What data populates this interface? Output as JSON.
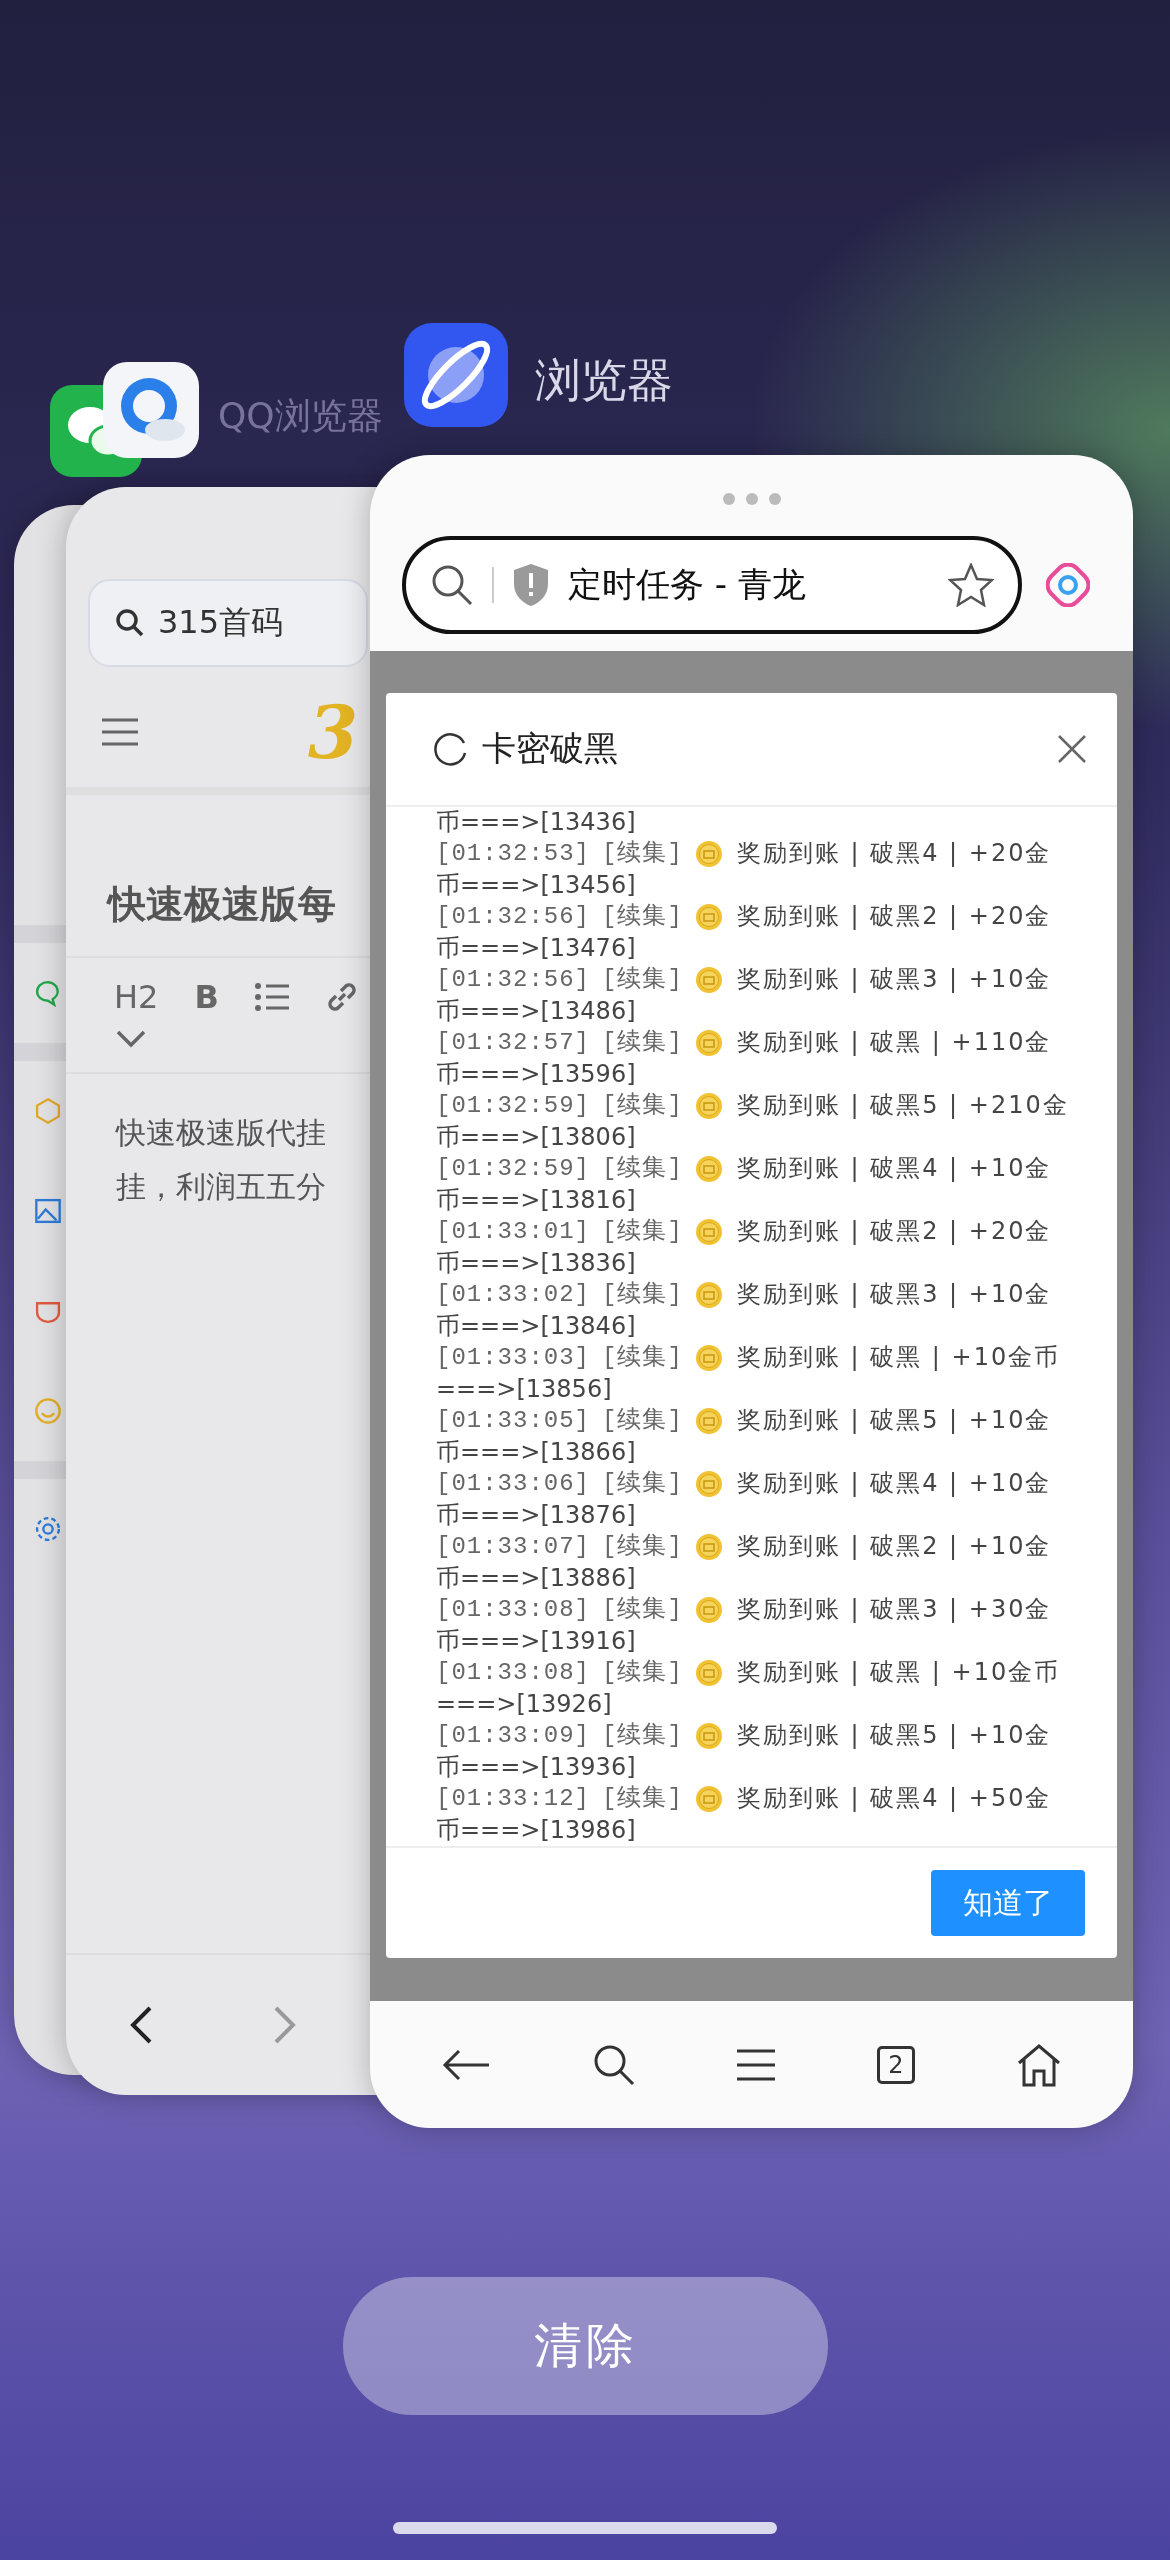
{
  "qq_browser_card": {
    "label": "QQ浏览器",
    "search": {
      "value": "315首码"
    },
    "logo_text": "3",
    "title": "快速极速版每",
    "toolbar": [
      "H2",
      "B"
    ],
    "body": [
      "快速极速版代挂",
      "挂，利润五五分"
    ],
    "nav": [
      {
        "kind": "back",
        "disabled": false
      },
      {
        "kind": "forward",
        "disabled": true
      }
    ]
  },
  "browser_card": {
    "label": "浏览器",
    "address": {
      "title": "定时任务 - 青龙"
    },
    "dialog": {
      "title": "卡密破黑",
      "log": [
        {
          "kind": "fragment",
          "text": "币===>[13436]"
        },
        {
          "kind": "entry",
          "time": "[01:32:53]",
          "tag": "[续集]",
          "message": "奖励到账 | 破黑4 | +20金",
          "continuation": "币===>[13456]"
        },
        {
          "kind": "entry",
          "time": "[01:32:56]",
          "tag": "[续集]",
          "message": "奖励到账 | 破黑2 | +20金",
          "continuation": "币===>[13476]"
        },
        {
          "kind": "entry",
          "time": "[01:32:56]",
          "tag": "[续集]",
          "message": "奖励到账 | 破黑3 | +10金",
          "continuation": "币===>[13486]"
        },
        {
          "kind": "entry",
          "time": "[01:32:57]",
          "tag": "[续集]",
          "message": "奖励到账 | 破黑 | +110金",
          "continuation": "币===>[13596]"
        },
        {
          "kind": "entry",
          "time": "[01:32:59]",
          "tag": "[续集]",
          "message": "奖励到账 | 破黑5 | +210金",
          "continuation": "币===>[13806]"
        },
        {
          "kind": "entry",
          "time": "[01:32:59]",
          "tag": "[续集]",
          "message": "奖励到账 | 破黑4 | +10金",
          "continuation": "币===>[13816]"
        },
        {
          "kind": "entry",
          "time": "[01:33:01]",
          "tag": "[续集]",
          "message": "奖励到账 | 破黑2 | +20金",
          "continuation": "币===>[13836]"
        },
        {
          "kind": "entry",
          "time": "[01:33:02]",
          "tag": "[续集]",
          "message": "奖励到账 | 破黑3 | +10金",
          "continuation": "币===>[13846]"
        },
        {
          "kind": "entry",
          "time": "[01:33:03]",
          "tag": "[续集]",
          "message": "奖励到账 | 破黑 | +10金币",
          "continuation": "===>[13856]"
        },
        {
          "kind": "entry",
          "time": "[01:33:05]",
          "tag": "[续集]",
          "message": "奖励到账 | 破黑5 | +10金",
          "continuation": "币===>[13866]"
        },
        {
          "kind": "entry",
          "time": "[01:33:06]",
          "tag": "[续集]",
          "message": "奖励到账 | 破黑4 | +10金",
          "continuation": "币===>[13876]"
        },
        {
          "kind": "entry",
          "time": "[01:33:07]",
          "tag": "[续集]",
          "message": "奖励到账 | 破黑2 | +10金",
          "continuation": "币===>[13886]"
        },
        {
          "kind": "entry",
          "time": "[01:33:08]",
          "tag": "[续集]",
          "message": "奖励到账 | 破黑3 | +30金",
          "continuation": "币===>[13916]"
        },
        {
          "kind": "entry",
          "time": "[01:33:08]",
          "tag": "[续集]",
          "message": "奖励到账 | 破黑 | +10金币",
          "continuation": "===>[13926]"
        },
        {
          "kind": "entry",
          "time": "[01:33:09]",
          "tag": "[续集]",
          "message": "奖励到账 | 破黑5 | +10金",
          "continuation": "币===>[13936]"
        },
        {
          "kind": "entry",
          "time": "[01:33:12]",
          "tag": "[续集]",
          "message": "奖励到账 | 破黑4 | +50金",
          "continuation": "币===>[13986]"
        }
      ],
      "button": "知道了"
    },
    "tab_count": "2"
  },
  "clear_button": "清除"
}
